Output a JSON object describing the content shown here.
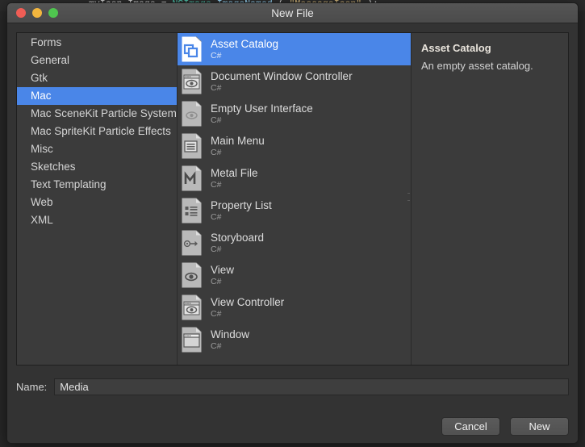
{
  "backdrop_code": {
    "segments": [
      {
        "text": "myIcon.Image = ",
        "cls": "tok-plain"
      },
      {
        "text": "NSImage",
        "cls": "tok-type"
      },
      {
        "text": ".",
        "cls": "tok-punc"
      },
      {
        "text": "ImageNamed",
        "cls": "tok-memb"
      },
      {
        "text": " ( ",
        "cls": "tok-punc"
      },
      {
        "text": "\"MessageIcon\"",
        "cls": "tok-str"
      },
      {
        "text": " );",
        "cls": "tok-punc"
      }
    ]
  },
  "window": {
    "title": "New File",
    "traffic_lights": [
      {
        "name": "close-button",
        "color": "#f05d55"
      },
      {
        "name": "minimize-button",
        "color": "#f3b63e"
      },
      {
        "name": "zoom-button",
        "color": "#4fc54f"
      }
    ]
  },
  "colors": {
    "selection_blue": "#4a86e8",
    "window_bg": "#333333",
    "pane_bg": "#3b3b3b",
    "text_primary": "#d4d4d4",
    "text_secondary": "#9a9a9a"
  },
  "categories": {
    "selected_index": 3,
    "items": [
      {
        "label": "Forms"
      },
      {
        "label": "General"
      },
      {
        "label": "Gtk"
      },
      {
        "label": "Mac"
      },
      {
        "label": "Mac SceneKit Particle Systems"
      },
      {
        "label": "Mac SpriteKit Particle Effects"
      },
      {
        "label": "Misc"
      },
      {
        "label": "Sketches"
      },
      {
        "label": "Text Templating"
      },
      {
        "label": "Web"
      },
      {
        "label": "XML"
      }
    ]
  },
  "templates": {
    "selected_index": 0,
    "items": [
      {
        "label": "Asset Catalog",
        "language": "C#",
        "icon": "asset-catalog-icon"
      },
      {
        "label": "Document Window Controller",
        "language": "C#",
        "icon": "document-window-controller-icon"
      },
      {
        "label": "Empty User Interface",
        "language": "C#",
        "icon": "empty-user-interface-icon"
      },
      {
        "label": "Main Menu",
        "language": "C#",
        "icon": "main-menu-icon"
      },
      {
        "label": "Metal File",
        "language": "C#",
        "icon": "metal-file-icon"
      },
      {
        "label": "Property List",
        "language": "C#",
        "icon": "property-list-icon"
      },
      {
        "label": "Storyboard",
        "language": "C#",
        "icon": "storyboard-icon"
      },
      {
        "label": "View",
        "language": "C#",
        "icon": "view-icon"
      },
      {
        "label": "View Controller",
        "language": "C#",
        "icon": "view-controller-icon"
      },
      {
        "label": "Window",
        "language": "C#",
        "icon": "window-icon"
      }
    ]
  },
  "detail": {
    "title": "Asset Catalog",
    "description": "An empty asset catalog."
  },
  "name_field": {
    "label": "Name:",
    "value": "Media",
    "placeholder": ""
  },
  "footer": {
    "cancel_label": "Cancel",
    "new_label": "New"
  }
}
